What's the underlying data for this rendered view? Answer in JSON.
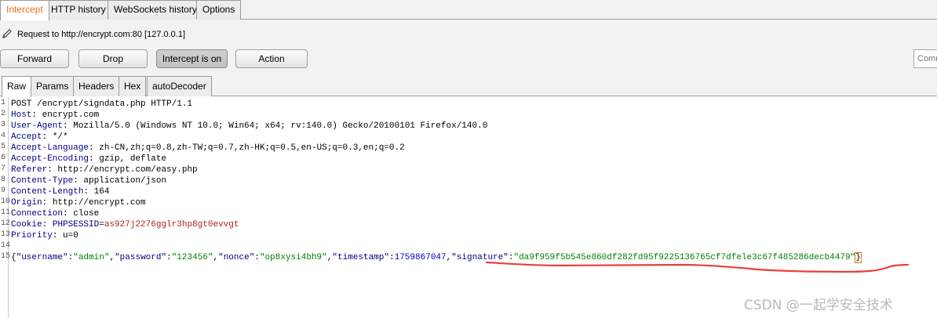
{
  "top_tabs": [
    "Intercept",
    "HTTP history",
    "WebSockets history",
    "Options"
  ],
  "request_line": "Request to http://encrypt.com:80  [127.0.0.1]",
  "buttons": {
    "forward": "Forward",
    "drop": "Drop",
    "intercept": "Intercept is on",
    "action": "Action"
  },
  "comment_placeholder": "Comm",
  "sub_tabs": [
    "Raw",
    "Params",
    "Headers",
    "Hex",
    "autoDecoder"
  ],
  "line_numbers": [
    "1",
    "2",
    "3",
    "4",
    "5",
    "6",
    "7",
    "8",
    "9",
    "10",
    "11",
    "12",
    "13",
    "14",
    "15"
  ],
  "request": {
    "request_line": "POST /encrypt/signdata.php HTTP/1.1",
    "headers": [
      {
        "name": "Host",
        "value": " encrypt.com"
      },
      {
        "name": "User-Agent",
        "value": " Mozilla/5.0 (Windows NT 10.0; Win64; x64; rv:140.0) Gecko/20100101 Firefox/140.0"
      },
      {
        "name": "Accept",
        "value": " */*"
      },
      {
        "name": "Accept-Language",
        "value": " zh-CN,zh;q=0.8,zh-TW;q=0.7,zh-HK;q=0.5,en-US;q=0.3,en;q=0.2"
      },
      {
        "name": "Accept-Encoding",
        "value": " gzip, deflate"
      },
      {
        "name": "Referer",
        "value": " http://encrypt.com/easy.php"
      },
      {
        "name": "Content-Type",
        "value": " application/json"
      },
      {
        "name": "Content-Length",
        "value": " 164"
      },
      {
        "name": "Origin",
        "value": " http://encrypt.com"
      },
      {
        "name": "Connection",
        "value": " close"
      }
    ],
    "cookie": {
      "label": "Cookie: ",
      "name": "PHPSESSID",
      "eq": "=",
      "value": "as927j2276gglr3hp8gt0evvgt"
    },
    "priority": {
      "name": "Priority",
      "value": " u=0"
    },
    "body": {
      "open": "{",
      "k_username": "\"username\"",
      "v_username": "\"admin\"",
      "k_password": "\"password\"",
      "v_password": "\"123456\"",
      "k_nonce": "\"nonce\"",
      "v_nonce": "\"op8xysi4bh9\"",
      "k_timestamp": "\"timestamp\"",
      "v_timestamp": "1759867047",
      "k_signature": "\"signature\"",
      "v_signature": "\"da9f959f5b545e860df282fd95f9225136765cf7dfele3c67f485286decb4479\"",
      "close": "}",
      "colon": ":",
      "comma": ","
    }
  },
  "annotation_color": "#e8403a",
  "accent_color": "#e8701a",
  "watermark": "CSDN @一起学安全技术"
}
